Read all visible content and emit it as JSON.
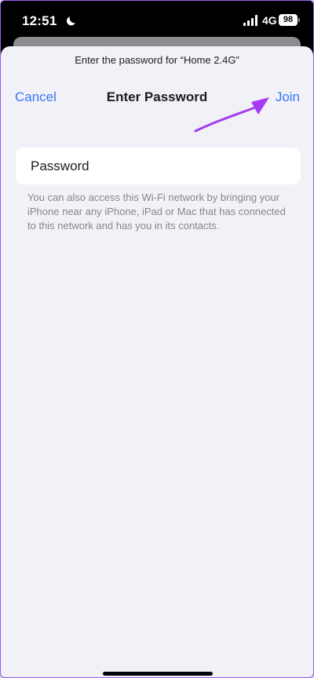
{
  "status_bar": {
    "time": "12:51",
    "network": "4G",
    "battery": "98",
    "icons": [
      "moon-icon",
      "signal-icon",
      "battery-icon"
    ]
  },
  "dialog": {
    "prompt": "Enter the password for “Home 2.4G”",
    "title": "Enter Password",
    "cancel_label": "Cancel",
    "join_label": "Join",
    "password_placeholder": "Password",
    "info_text": "You can also access this Wi-Fi network by bringing your iPhone near any iPhone, iPad or Mac that has connected to this network and has you in its contacts."
  },
  "colors": {
    "accent": "#3478f6",
    "annotation_arrow": "#a43cf2",
    "background": "#f2f1f7"
  }
}
